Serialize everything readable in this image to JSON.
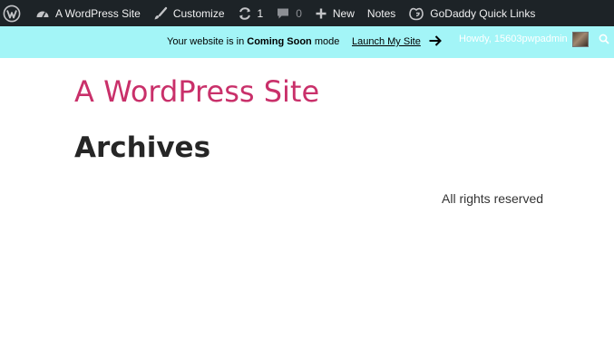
{
  "adminbar": {
    "site_name": "A WordPress Site",
    "customize": "Customize",
    "updates_count": "1",
    "comments_count": "0",
    "new_label": "New",
    "notes_label": "Notes",
    "godaddy_label": "GoDaddy Quick Links"
  },
  "notice": {
    "prefix": "Your website is in ",
    "mode": "Coming Soon",
    "suffix": " mode",
    "launch_link": "Launch My Site",
    "howdy": "Howdy, 15603pwpadmin"
  },
  "content": {
    "site_title": "A WordPress Site",
    "page_title": "Archives",
    "footer_text": "All rights reserved"
  },
  "colors": {
    "adminbar_bg": "#1d2327",
    "notice_bg": "#a3f5f7",
    "site_title": "#c9306a"
  }
}
